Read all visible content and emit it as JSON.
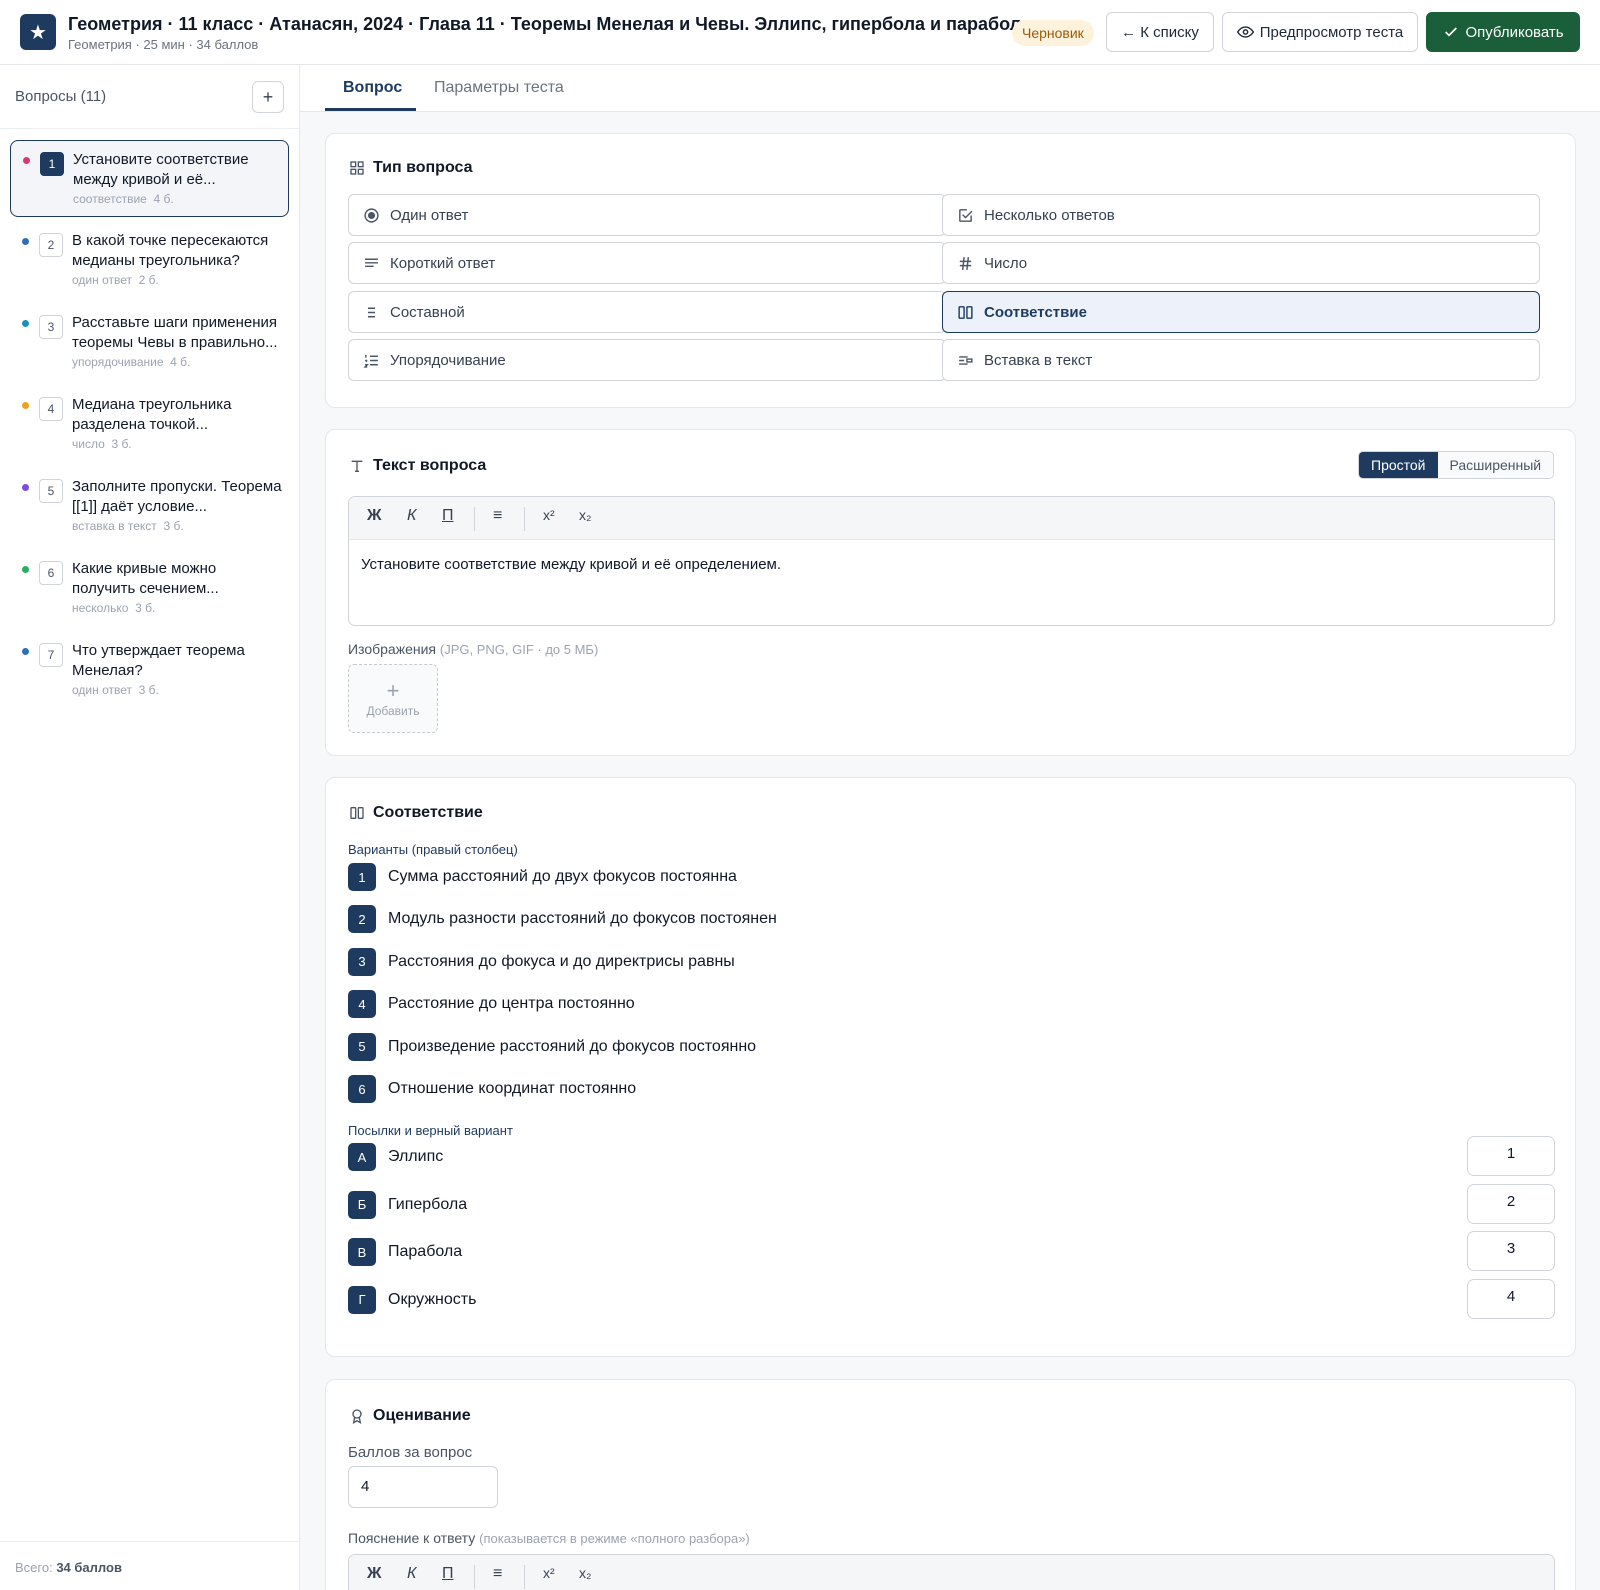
{
  "header": {
    "logo_glyph": "★",
    "title": "Геометрия · 11 класс · Атанасян, 2024 · Глава 11 · Теоремы Менелая и Чевы. Эллипс, гипербола и парабола",
    "subtitle": "Геометрия · 25 мин · 34 баллов",
    "status_badge": "Черновик",
    "back_label": "← К списку",
    "preview_label": "Предпросмотр теста",
    "publish_label": "Опубликовать"
  },
  "sidebar": {
    "title": "Вопросы (11)",
    "add_label": "+",
    "items": [
      {
        "num": "1",
        "text": "Установите соответствие между кривой и её...",
        "type": "соответствие",
        "points": "4 б.",
        "color": "#d63a6b",
        "active": true
      },
      {
        "num": "2",
        "text": "В какой точке пересекаются медианы треугольника?",
        "type": "один ответ",
        "points": "2 б.",
        "color": "#2f6fb6"
      },
      {
        "num": "3",
        "text": "Расставьте шаги применения теоремы Чевы в правильно...",
        "type": "упорядочивание",
        "points": "4 б.",
        "color": "#1d8fb8"
      },
      {
        "num": "4",
        "text": "Медиана треугольника разделена точкой...",
        "type": "число",
        "points": "3 б.",
        "color": "#f0a020"
      },
      {
        "num": "5",
        "text": "Заполните пропуски. Теорема [[1]] даёт условие...",
        "type": "вставка в текст",
        "points": "3 б.",
        "color": "#7c4ddb"
      },
      {
        "num": "6",
        "text": "Какие кривые можно получить сечением...",
        "type": "несколько",
        "points": "3 б.",
        "color": "#27ae60"
      },
      {
        "num": "7",
        "text": "Что утверждает теорема Менелая?",
        "type": "один ответ",
        "points": "3 б.",
        "color": "#2f6fb6"
      }
    ],
    "footer_label": "Всего:",
    "footer_value": "34 баллов"
  },
  "tabs": [
    {
      "label": "Вопрос",
      "active": true
    },
    {
      "label": "Параметры теста",
      "active": false
    }
  ],
  "question_type": {
    "title": "Тип вопроса",
    "options": [
      {
        "label": "Один ответ",
        "icon": "radio-icon"
      },
      {
        "label": "Несколько ответов",
        "icon": "checkbox-icon"
      },
      {
        "label": "Короткий ответ",
        "icon": "short-text-icon"
      },
      {
        "label": "Число",
        "icon": "hash-icon"
      },
      {
        "label": "Составной",
        "icon": "list-icon"
      },
      {
        "label": "Соответствие",
        "icon": "columns-icon",
        "selected": true
      },
      {
        "label": "Упорядочивание",
        "icon": "ordered-list-icon"
      },
      {
        "label": "Вставка в текст",
        "icon": "insert-text-icon"
      }
    ]
  },
  "question_text": {
    "title": "Текст вопроса",
    "mode_simple": "Простой",
    "mode_extended": "Расширенный",
    "toolbar": {
      "bold": "Ж",
      "italic": "К",
      "underline": "П",
      "list": "≡",
      "sup": "x²",
      "sub": "x₂"
    },
    "body": "Установите соответствие между кривой и её определением.",
    "images_label": "Изображения",
    "images_hint": "(JPG, PNG, GIF · до 5 МБ)",
    "add_image_plus": "+",
    "add_image_label": "Добавить"
  },
  "matching": {
    "title": "Соответствие",
    "variants_label": "Варианты (правый столбец)",
    "variants": [
      {
        "num": "1",
        "text": "Сумма расстояний до двух фокусов постоянна"
      },
      {
        "num": "2",
        "text": "Модуль разности расстояний до фокусов постоянен"
      },
      {
        "num": "3",
        "text": "Расстояния до фокуса и до директрисы равны"
      },
      {
        "num": "4",
        "text": "Расстояние до центра постоянно"
      },
      {
        "num": "5",
        "text": "Произведение расстояний до фокусов постоянно"
      },
      {
        "num": "6",
        "text": "Отношение координат постоянно"
      }
    ],
    "premises_label": "Посылки и верный вариант",
    "premises": [
      {
        "letter": "А",
        "text": "Эллипс",
        "answer": "1"
      },
      {
        "letter": "Б",
        "text": "Гипербола",
        "answer": "2"
      },
      {
        "letter": "В",
        "text": "Парабола",
        "answer": "3"
      },
      {
        "letter": "Г",
        "text": "Окружность",
        "answer": "4"
      }
    ]
  },
  "grading": {
    "title": "Оценивание",
    "points_label": "Баллов за вопрос",
    "points_value": "4",
    "explanation_label": "Пояснение к ответу",
    "explanation_hint": "(показывается в режиме «полного разбора»)"
  }
}
